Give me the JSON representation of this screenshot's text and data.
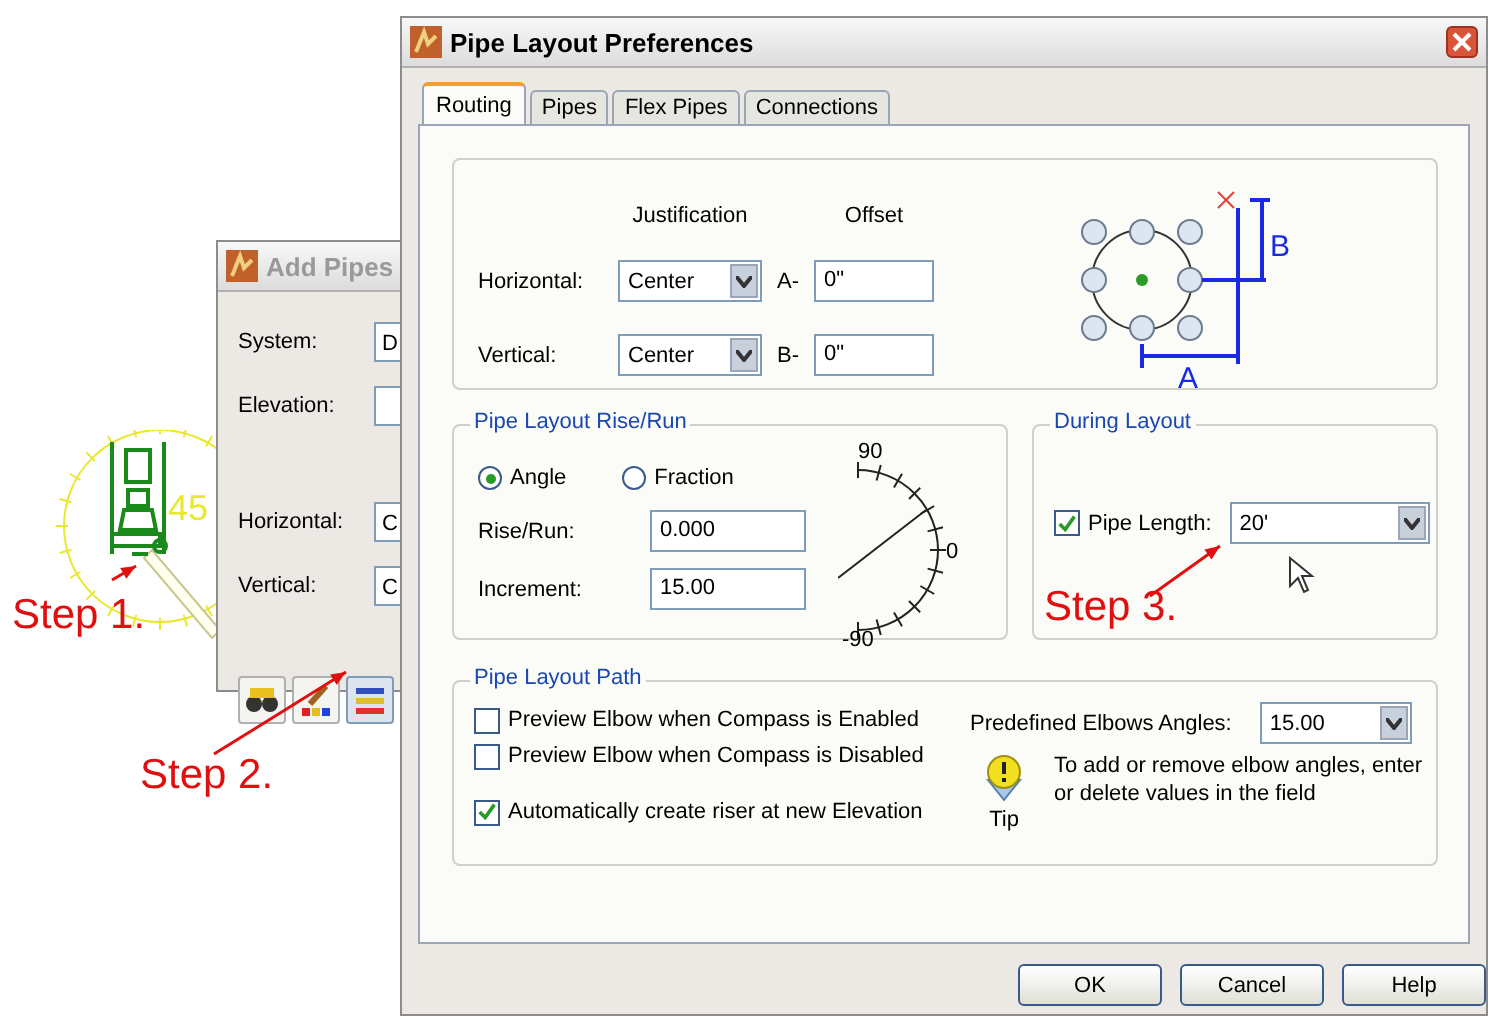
{
  "canvas": {
    "compass_label": "45",
    "annotations": [
      {
        "text": "Step 1."
      },
      {
        "text": "Step 2."
      },
      {
        "text": "Step 3."
      }
    ]
  },
  "add_pipes": {
    "title": "Add Pipes",
    "fields": [
      {
        "label": "System:",
        "value": "D"
      },
      {
        "label": "Elevation:"
      },
      {
        "label": "Horizontal:",
        "value": "C"
      },
      {
        "label": "Vertical:",
        "value": "C"
      }
    ]
  },
  "dialog": {
    "title": "Pipe Layout Preferences",
    "tabs": [
      {
        "label": "Routing",
        "selected": true
      },
      {
        "label": "Pipes",
        "selected": false
      },
      {
        "label": "Flex Pipes",
        "selected": false
      },
      {
        "label": "Connections",
        "selected": false
      }
    ],
    "justification": {
      "headers": [
        "Justification",
        "Offset"
      ],
      "rows": [
        {
          "label": "Horizontal:",
          "value": "Center",
          "offset_label": "A-",
          "offset": "0\""
        },
        {
          "label": "Vertical:",
          "value": "Center",
          "offset_label": "B-",
          "offset": "0\""
        }
      ],
      "diagram_labels": [
        "B",
        "A"
      ]
    },
    "rise_run": {
      "title": "Pipe Layout Rise/Run",
      "options": [
        {
          "label": "Angle",
          "selected": true
        },
        {
          "label": "Fraction",
          "selected": false
        }
      ],
      "fields": [
        {
          "label": "Rise/Run:",
          "value": "0.000"
        },
        {
          "label": "Increment:",
          "value": "15.00"
        }
      ],
      "gauge_labels": [
        "90",
        "0",
        "-90"
      ]
    },
    "during_layout": {
      "title": "During Layout",
      "label": "Pipe Length:",
      "checked": true,
      "value": "20'"
    },
    "path": {
      "title": "Pipe Layout Path",
      "options": [
        {
          "label": "Preview Elbow when Compass is Enabled",
          "checked": false
        },
        {
          "label": "Preview Elbow when Compass is Disabled",
          "checked": false
        },
        {
          "label": "Automatically create riser at new Elevation",
          "checked": true
        }
      ],
      "elbows": {
        "label": "Predefined Elbows Angles:",
        "value": "15.00"
      },
      "tip": {
        "label": "Tip",
        "text": "To add or remove elbow angles, enter or delete values in the field"
      }
    },
    "buttons": [
      "OK",
      "Cancel",
      "Help"
    ]
  }
}
